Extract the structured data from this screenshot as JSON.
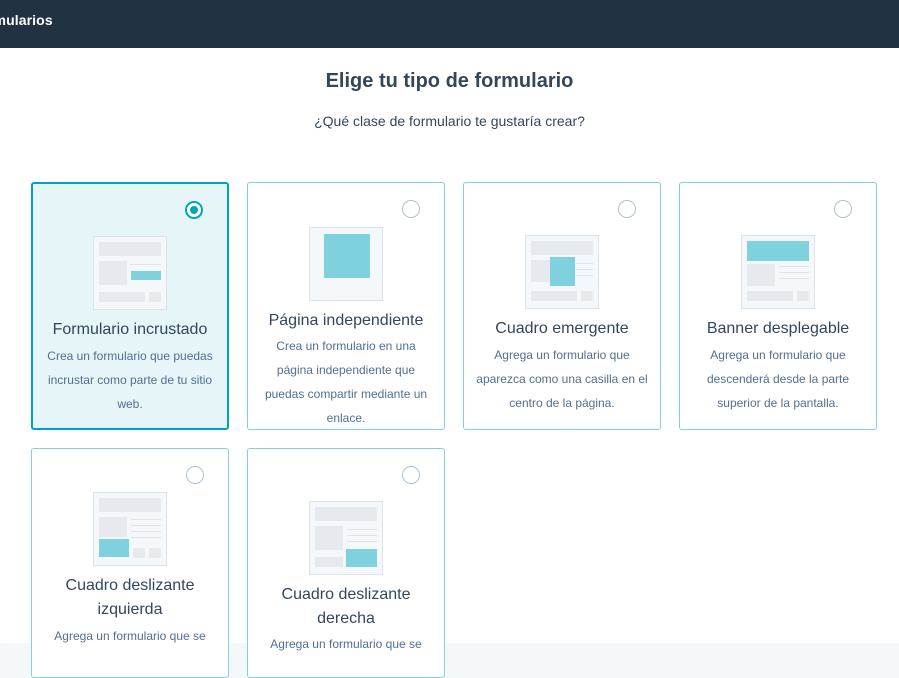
{
  "header": {
    "title": "rmularios"
  },
  "page": {
    "title": "Elige tu tipo de formulario",
    "subtitle": "¿Qué clase de formulario te gustaría crear?"
  },
  "colors": {
    "accent": "#00a4bd",
    "accent_light": "#7fd1de",
    "header_bg": "#213343"
  },
  "form_types": [
    {
      "title": "Formulario incrustado",
      "description": "Crea un formulario que puedas incrustar como parte de tu sitio web.",
      "selected": true,
      "icon": "embedded-form-illustration"
    },
    {
      "title": "Página independiente",
      "description": "Crea un formulario en una página independiente que puedas compartir mediante un enlace.",
      "selected": false,
      "icon": "standalone-page-illustration"
    },
    {
      "title": "Cuadro emergente",
      "description": "Agrega un formulario que aparezca como una casilla en el centro de la página.",
      "selected": false,
      "icon": "popup-box-illustration"
    },
    {
      "title": "Banner desplegable",
      "description": "Agrega un formulario que descenderá desde la parte superior de la pantalla.",
      "selected": false,
      "icon": "dropdown-banner-illustration"
    },
    {
      "title": "Cuadro deslizante izquierda",
      "description": "Agrega un formulario que se",
      "selected": false,
      "icon": "slide-in-left-illustration"
    },
    {
      "title": "Cuadro deslizante derecha",
      "description": "Agrega un formulario que se",
      "selected": false,
      "icon": "slide-in-right-illustration"
    }
  ]
}
